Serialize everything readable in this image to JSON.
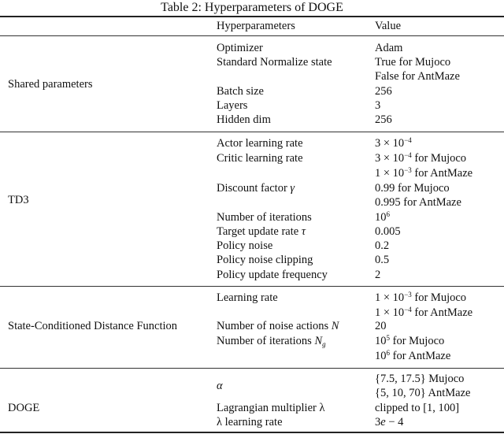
{
  "caption": "Table 2: Hyperparameters of DOGE",
  "header": {
    "group": "",
    "param": "Hyperparameters",
    "value": "Value"
  },
  "sections": [
    {
      "group": "Shared parameters",
      "rows": [
        {
          "param": "Optimizer",
          "value": [
            "Adam"
          ]
        },
        {
          "param": "Standard Normalize state",
          "value": [
            "True for Mujoco",
            "False for AntMaze"
          ]
        },
        {
          "param": "Batch size",
          "value": [
            "256"
          ]
        },
        {
          "param": "Layers",
          "value": [
            "3"
          ]
        },
        {
          "param": "Hidden dim",
          "value": [
            "256"
          ]
        }
      ]
    },
    {
      "group": "TD3",
      "rows": [
        {
          "param": "Actor learning rate",
          "value": [
            "3 × 10^-4"
          ]
        },
        {
          "param": "Critic learning rate",
          "value": [
            "3 × 10^-4 for Mujoco",
            "1 × 10^-3 for AntMaze"
          ]
        },
        {
          "param": "Discount factor γ",
          "value": [
            "0.99 for Mujoco",
            "0.995 for AntMaze"
          ]
        },
        {
          "param": "Number of iterations",
          "value": [
            "10^6"
          ]
        },
        {
          "param": "Target update rate τ",
          "value": [
            "0.005"
          ]
        },
        {
          "param": "Policy noise",
          "value": [
            "0.2"
          ]
        },
        {
          "param": "Policy noise clipping",
          "value": [
            "0.5"
          ]
        },
        {
          "param": "Policy update frequency",
          "value": [
            "2"
          ]
        }
      ]
    },
    {
      "group": "State-Conditioned Distance Function",
      "rows": [
        {
          "param": "Learning rate",
          "value": [
            "1 × 10^-3 for Mujoco",
            "1 × 10^-4 for AntMaze"
          ]
        },
        {
          "param": "Number of noise actions N",
          "value": [
            "20"
          ]
        },
        {
          "param": "Number of iterations N_g",
          "value": [
            "10^5 for Mujoco",
            "10^6 for AntMaze"
          ]
        }
      ]
    },
    {
      "group": "DOGE",
      "rows": [
        {
          "param": "α",
          "value": [
            "{7.5, 17.5} Mujoco",
            "{5, 10, 70} AntMaze"
          ]
        },
        {
          "param": "Lagrangian multiplier λ",
          "value": [
            "clipped to [1, 100]"
          ]
        },
        {
          "param": "λ learning rate",
          "value": [
            "3e − 4"
          ]
        }
      ]
    }
  ],
  "text": {
    "times": "3 × 10",
    "times1": "1 × 10",
    "ten": "10",
    "e_m4": "−4",
    "e_m3": "−3",
    "e5": "5",
    "e6": "6",
    "for_mujoco": " for Mujoco",
    "for_antmaze": " for AntMaze",
    "gamma": "γ",
    "tau": "τ",
    "N": "N",
    "g": "g",
    "alpha": "α",
    "lambda": "λ",
    "e": "e",
    "discount": "Discount factor ",
    "target": "Target update rate ",
    "noise_actions": "Number of noise actions ",
    "iters": "Number of iterations ",
    "lagr": "Lagrangian multiplier ",
    "lr_suffix": " learning rate",
    "three": "3",
    "minus4": " − 4"
  }
}
